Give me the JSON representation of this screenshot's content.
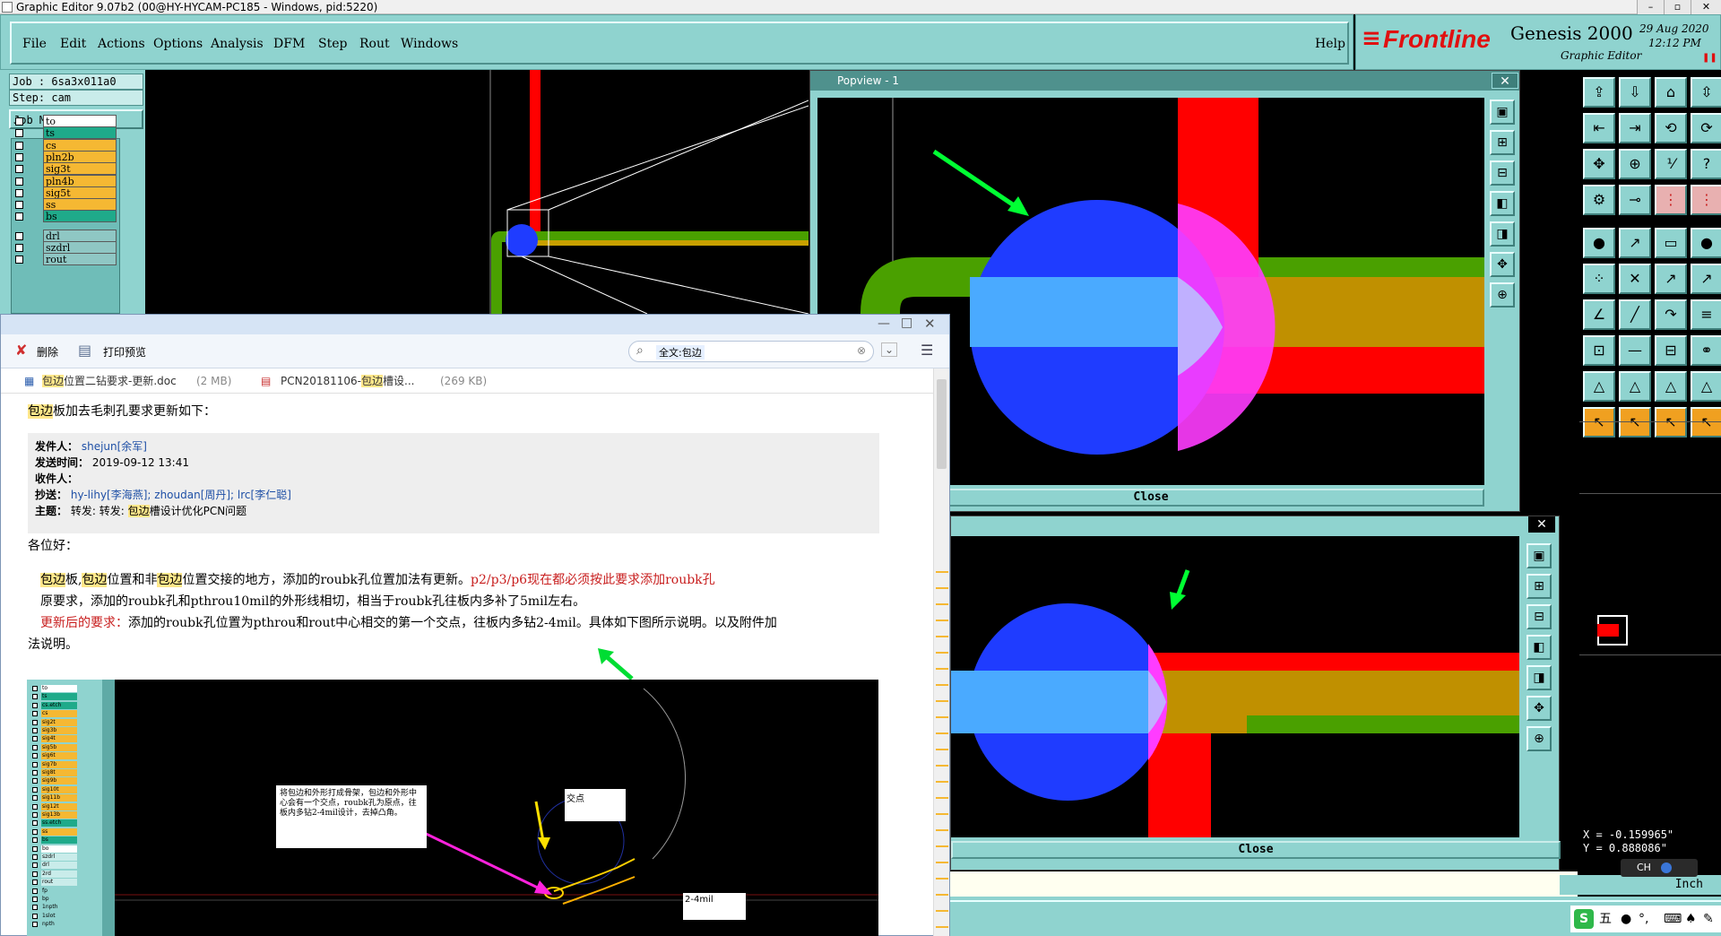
{
  "window": {
    "title": "Graphic Editor 9.07b2 (00@HY-HYCAM-PC185 - Windows, pid:5220)"
  },
  "menubar": {
    "items": [
      "File",
      "Edit",
      "Actions",
      "Options",
      "Analysis",
      "DFM",
      "Step",
      "Rout",
      "Windows"
    ],
    "help": "Help"
  },
  "logo": {
    "brand": "Frontline",
    "product": "Genesis 2000",
    "subtitle": "Graphic Editor",
    "date": "29 Aug 2020",
    "time": "12:12 PM"
  },
  "job": {
    "job_label": "Job : 6sa3x011a0",
    "step_label": "Step: cam",
    "matrix_button": "Job Matrix ..."
  },
  "layers": [
    {
      "name": "to",
      "color": "#ffffff"
    },
    {
      "name": "ts",
      "color": "#1faa8a"
    },
    {
      "name": "cs",
      "color": "#f5b833"
    },
    {
      "name": "pln2b",
      "color": "#f5b833"
    },
    {
      "name": "sig3t",
      "color": "#f5b833"
    },
    {
      "name": "pln4b",
      "color": "#f5b833"
    },
    {
      "name": "sig5t",
      "color": "#f5b833"
    },
    {
      "name": "ss",
      "color": "#f5b833"
    },
    {
      "name": "bs",
      "color": "#1faa8a"
    },
    {
      "name": "drl",
      "color": "#8fc7c4"
    },
    {
      "name": "szdrl",
      "color": "#8fc7c4"
    },
    {
      "name": "rout",
      "color": "#8fc7c4"
    }
  ],
  "popview1": {
    "title": "Popview - 1",
    "close_label": "Close"
  },
  "popview2": {
    "close_label": "Close"
  },
  "mail": {
    "toolbar": {
      "delete": "删除",
      "print_preview": "打印预览",
      "search_value": "全文:包边"
    },
    "attachments": [
      {
        "name_hl": "包边",
        "name_rest": "位置二钻要求-更新.doc",
        "size": "(2 MB)"
      },
      {
        "name_pre": "PCN20181106-",
        "name_hl": "包边",
        "name_rest": "槽设...",
        "size": "(269 KB)"
      }
    ],
    "heading_hl": "包边",
    "heading_rest": "板加去毛刺孔要求更新如下：",
    "header": {
      "from_label": "发件人：",
      "from": "shejun[余军]",
      "sent_label": "发送时间：",
      "sent": "2019-09-12 13:41",
      "to_label": "收件人：",
      "cc_label": "抄送：",
      "cc": "hy-lihy[李海燕]; zhoudan[周丹]; lrc[李仁聪]",
      "subject_label": "主题：",
      "subject_pre": "转发: 转发: ",
      "subject_hl": "包边",
      "subject_rest": "槽设计优化PCN问题"
    },
    "greeting": "各位好：",
    "p1_a": "包边",
    "p1_b": "板,",
    "p1_c": "包边",
    "p1_d": "位置和非",
    "p1_e": "包边",
    "p1_f": "位置交接的地方，添加的roubk孔位置加法有更新。",
    "p1_red": "p2/p3/p6现在都必须按此要求添加roubk孔",
    "p2": "原要求，添加的roubk孔和pthrou10mil的外形线相切，相当于roubk孔往板内多补了5mil左右。",
    "p3_red": "更新后的要求：",
    "p3": "添加的roubk孔位置为pthrou和rout中心相交的第一个交点，往板内多钻2-4mil。具体如下图所示说明。以及附件加",
    "p3_cont": "法说明。",
    "figure": {
      "note": "将包边和外形打成骨架，包边和外形中心会有一个交点，roubk孔为原点，往板内多钻2-4mil设计，去掉凸角。",
      "label_point": "交点",
      "label_mil": "2-4mil",
      "layers": [
        "to",
        "ts",
        "cs.etch",
        "cs",
        "sig2t",
        "sig3b",
        "sig4t",
        "sig5b",
        "sig6t",
        "sig7b",
        "sig8t",
        "sig9b",
        "sig10t",
        "sig11b",
        "sig12t",
        "sig13b",
        "ss.etch",
        "ss",
        "bs",
        "bo",
        "szdrl",
        "drl",
        "2rd",
        "rout",
        "fp",
        "bp",
        "1npth",
        "1slot",
        "npth"
      ]
    }
  },
  "coords": {
    "x": "X = -0.159965\"",
    "y": "Y = 0.888086\"",
    "unit": "Inch"
  },
  "tray": {
    "ime": "五",
    "lang": "CH"
  },
  "colors": {
    "genesis_bg": "#8fd3cf",
    "pad_blue": "#1f3cff",
    "trace_red": "#ff0000",
    "trace_green": "#4aa000"
  }
}
